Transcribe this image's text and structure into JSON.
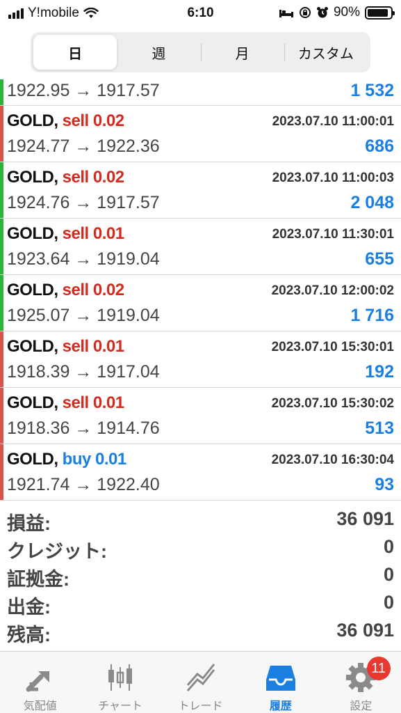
{
  "status_bar": {
    "carrier": "Y!mobile",
    "time": "6:10",
    "battery_percent": "90%",
    "battery_level": 0.9
  },
  "segment": {
    "tabs": [
      "日",
      "週",
      "月",
      "カスタム"
    ],
    "active_index": 0
  },
  "trades": [
    {
      "prices": "1922.95 → 1917.57",
      "profit": "1 532",
      "bar": "green",
      "partial": true
    },
    {
      "symbol": "GOLD,",
      "side": "sell 0.02",
      "datetime": "2023.07.10 11:00:01",
      "prices": "1924.77 → 1922.36",
      "profit": "686",
      "bar": "red"
    },
    {
      "symbol": "GOLD,",
      "side": "sell 0.02",
      "datetime": "2023.07.10 11:00:03",
      "prices": "1924.76 → 1917.57",
      "profit": "2 048",
      "bar": "green"
    },
    {
      "symbol": "GOLD,",
      "side": "sell 0.01",
      "datetime": "2023.07.10 11:30:01",
      "prices": "1923.64 → 1919.04",
      "profit": "655",
      "bar": "green"
    },
    {
      "symbol": "GOLD,",
      "side": "sell 0.02",
      "datetime": "2023.07.10 12:00:02",
      "prices": "1925.07 → 1919.04",
      "profit": "1 716",
      "bar": "green"
    },
    {
      "symbol": "GOLD,",
      "side": "sell 0.01",
      "datetime": "2023.07.10 15:30:01",
      "prices": "1918.39 → 1917.04",
      "profit": "192",
      "bar": "red"
    },
    {
      "symbol": "GOLD,",
      "side": "sell 0.01",
      "datetime": "2023.07.10 15:30:02",
      "prices": "1918.36 → 1914.76",
      "profit": "513",
      "bar": "red"
    },
    {
      "symbol": "GOLD,",
      "side": "buy 0.01",
      "datetime": "2023.07.10 16:30:04",
      "prices": "1921.74 → 1922.40",
      "profit": "93",
      "bar": "red"
    }
  ],
  "summary": [
    {
      "label": "損益:",
      "value": "36 091"
    },
    {
      "label": "クレジット:",
      "value": "0"
    },
    {
      "label": "証拠金:",
      "value": "0"
    },
    {
      "label": "出金:",
      "value": "0"
    },
    {
      "label": "残高:",
      "value": "36 091"
    }
  ],
  "tabbar": {
    "items": [
      {
        "label": "気配値",
        "icon": "quotes-icon"
      },
      {
        "label": "チャート",
        "icon": "chart-icon"
      },
      {
        "label": "トレード",
        "icon": "trade-icon"
      },
      {
        "label": "履歴",
        "icon": "history-icon"
      },
      {
        "label": "設定",
        "icon": "settings-icon"
      }
    ],
    "active_index": 3,
    "settings_badge": "11"
  },
  "colors": {
    "sell": "#d52b1e",
    "buy": "#1a7fe0",
    "profit": "#1a7fe0",
    "bar_green": "#2bb43a",
    "bar_red": "#d9534f",
    "badge": "#e8382f"
  }
}
